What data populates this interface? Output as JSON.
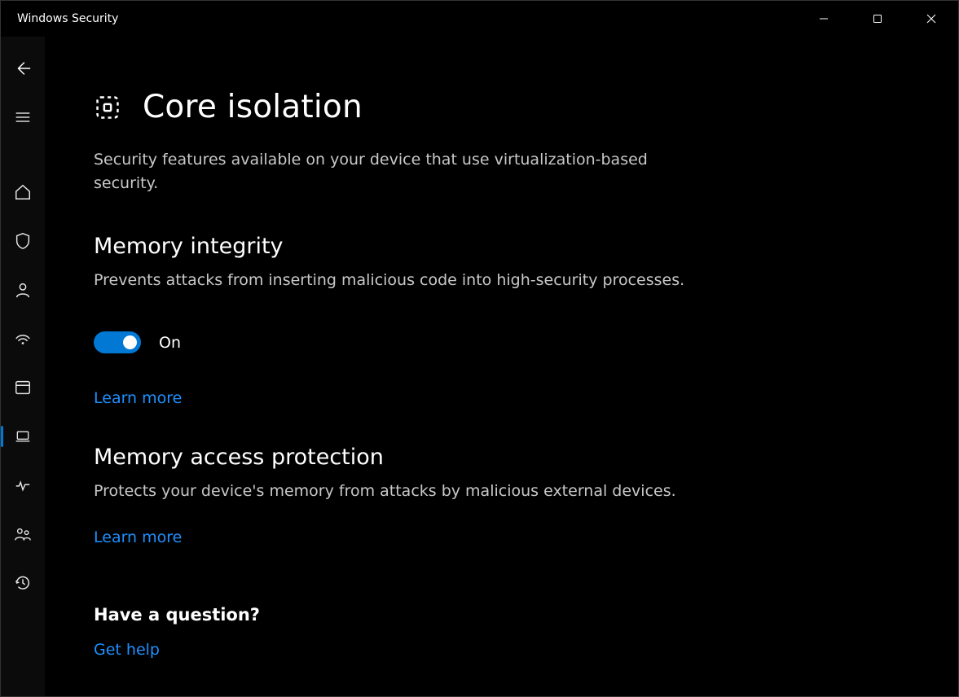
{
  "window": {
    "title": "Windows Security"
  },
  "sidebar": {
    "back": "back",
    "menu": "menu",
    "items": [
      {
        "name": "home",
        "selected": false
      },
      {
        "name": "virus",
        "selected": false
      },
      {
        "name": "account",
        "selected": false
      },
      {
        "name": "firewall",
        "selected": false
      },
      {
        "name": "app",
        "selected": false
      },
      {
        "name": "device",
        "selected": true
      },
      {
        "name": "perf",
        "selected": false
      },
      {
        "name": "family",
        "selected": false
      },
      {
        "name": "history",
        "selected": false
      }
    ]
  },
  "page": {
    "title": "Core isolation",
    "subtitle": "Security features available on your device that use virtualization-based security."
  },
  "memory_integrity": {
    "heading": "Memory integrity",
    "desc": "Prevents attacks from inserting malicious code into high-security processes.",
    "toggle_state": "On",
    "learn_more": "Learn more"
  },
  "memory_access": {
    "heading": "Memory access protection",
    "desc": "Protects your device's memory from attacks by malicious external devices.",
    "learn_more": "Learn more"
  },
  "help": {
    "heading": "Have a question?",
    "link": "Get help"
  }
}
